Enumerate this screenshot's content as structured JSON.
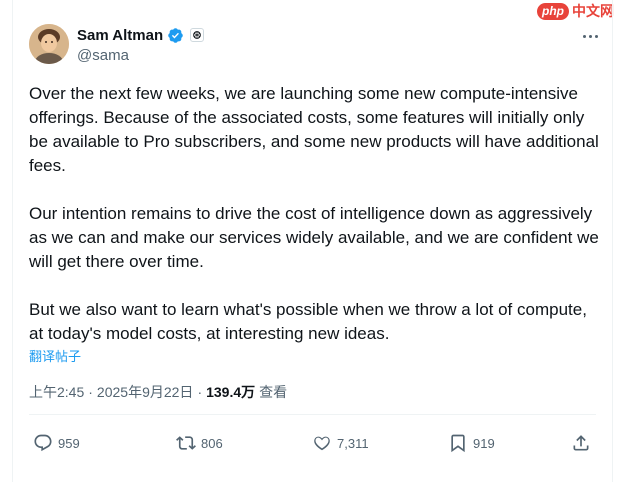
{
  "watermark": {
    "logo": "php",
    "text": "中文网"
  },
  "author": {
    "name": "Sam Altman",
    "handle": "@sama"
  },
  "tweet": {
    "paragraphs": [
      "Over the next few weeks, we are launching some new compute-intensive offerings. Because of the associated costs, some features will initially only be available to Pro subscribers, and some new products will have additional fees.",
      "Our intention remains to drive the cost of intelligence down as aggressively as we can and make our services widely available, and we are confident we will get there over time.",
      "But we also want to learn what's possible when we throw a lot of compute, at today's model costs, at interesting new ideas."
    ],
    "translate_label": "翻译帖子",
    "time": "上午2:45",
    "date": "2025年9月22日",
    "views_count": "139.4万",
    "views_label": "查看"
  },
  "actions": {
    "replies": "959",
    "reposts": "806",
    "likes": "7,311",
    "bookmarks": "919"
  },
  "colors": {
    "accent": "#1d9bf0",
    "text": "#0f1419",
    "muted": "#536471",
    "watermark": "#e8433a"
  }
}
